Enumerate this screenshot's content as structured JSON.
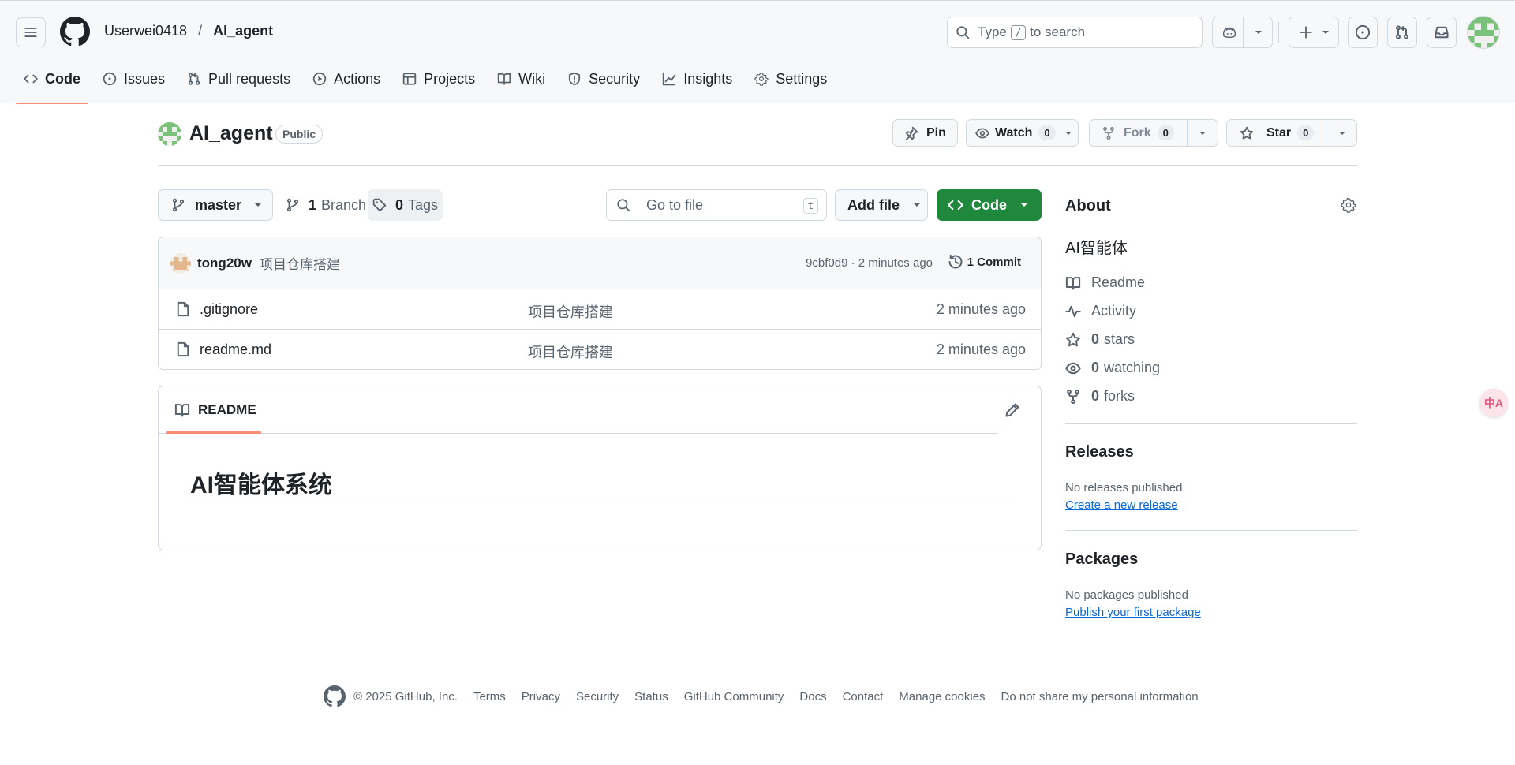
{
  "header": {
    "owner": "Userwei0418",
    "separator": "/",
    "repo": "AI_agent",
    "search_pre": "Type",
    "search_key": "/",
    "search_post": "to search"
  },
  "tabs": [
    {
      "label": "Code",
      "icon": "code-icon",
      "active": true
    },
    {
      "label": "Issues",
      "icon": "issue-icon"
    },
    {
      "label": "Pull requests",
      "icon": "pull-request-icon"
    },
    {
      "label": "Actions",
      "icon": "play-icon"
    },
    {
      "label": "Projects",
      "icon": "table-icon"
    },
    {
      "label": "Wiki",
      "icon": "book-icon"
    },
    {
      "label": "Security",
      "icon": "shield-icon"
    },
    {
      "label": "Insights",
      "icon": "graph-icon"
    },
    {
      "label": "Settings",
      "icon": "gear-icon"
    }
  ],
  "repo_header": {
    "title": "AI_agent",
    "visibility": "Public",
    "pin": "Pin",
    "watch": "Watch",
    "watch_count": "0",
    "fork": "Fork",
    "fork_count": "0",
    "star": "Star",
    "star_count": "0"
  },
  "toolbar": {
    "branch": "master",
    "branch_count": "1",
    "branch_label": "Branch",
    "tag_count": "0",
    "tag_label": "Tags",
    "go_to_file": "Go to file",
    "go_to_file_key": "t",
    "add_file": "Add file",
    "code": "Code"
  },
  "commit": {
    "user": "tong20w",
    "message": "项目仓库搭建",
    "meta": "9cbf0d9 · 2 minutes ago",
    "count": "1 Commit"
  },
  "files": [
    {
      "name": ".gitignore",
      "message": "项目仓库搭建",
      "time": "2 minutes ago"
    },
    {
      "name": "readme.md",
      "message": "项目仓库搭建",
      "time": "2 minutes ago"
    }
  ],
  "readme": {
    "tab": "README",
    "heading": "AI智能体系统"
  },
  "about": {
    "title": "About",
    "description": "AI智能体",
    "readme": "Readme",
    "activity": "Activity",
    "stars_count": "0",
    "stars_label": "stars",
    "watching_count": "0",
    "watching_label": "watching",
    "forks_count": "0",
    "forks_label": "forks"
  },
  "releases": {
    "title": "Releases",
    "note": "No releases published",
    "link": "Create a new release"
  },
  "packages": {
    "title": "Packages",
    "note": "No packages published",
    "link": "Publish your first package"
  },
  "footer": {
    "copyright": "© 2025 GitHub, Inc.",
    "links": [
      "Terms",
      "Privacy",
      "Security",
      "Status",
      "GitHub Community",
      "Docs",
      "Contact",
      "Manage cookies",
      "Do not share my personal information"
    ]
  },
  "translate_widget": "中A",
  "colors": {
    "accent_underline": "#fd8c73",
    "code_button": "#1f883d",
    "link": "#0969da"
  }
}
